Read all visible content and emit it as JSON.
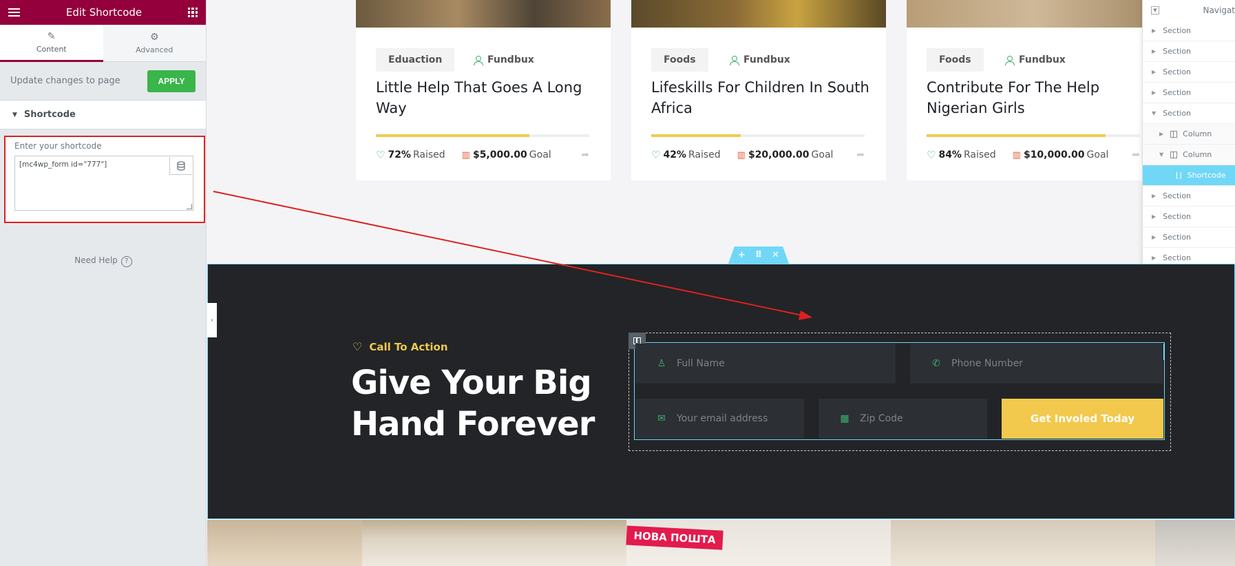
{
  "panel": {
    "title": "Edit Shortcode",
    "tabs": [
      {
        "label": "Content",
        "icon": "pencil-icon"
      },
      {
        "label": "Advanced",
        "icon": "gear-icon"
      }
    ],
    "update_text": "Update changes to page",
    "apply_label": "APPLY",
    "section_title": "Shortcode",
    "shortcode_label": "Enter your shortcode",
    "shortcode_value": "[mc4wp_form id=\"777\"]",
    "need_help": "Need Help"
  },
  "cards": [
    {
      "tag": "Eduaction",
      "author": "Fundbux",
      "title": "Little Help That Goes A Long Way",
      "progress": 0.72,
      "pct": "72%",
      "raised": "Raised",
      "goal_amount": "$5,000.00",
      "goal": "Goal"
    },
    {
      "tag": "Foods",
      "author": "Fundbux",
      "title": "Lifeskills For Children In South Africa",
      "progress": 0.42,
      "pct": "42%",
      "raised": "Raised",
      "goal_amount": "$20,000.00",
      "goal": "Goal"
    },
    {
      "tag": "Foods",
      "author": "Fundbux",
      "title": "Contribute For The Help Nigerian Girls",
      "progress": 0.84,
      "pct": "84%",
      "raised": "Raised",
      "goal_amount": "$10,000.00",
      "goal": "Goal"
    }
  ],
  "navigator": {
    "title": "Navigat",
    "items": [
      "Section",
      "Section",
      "Section",
      "Section",
      "Section",
      "Column",
      "Column",
      "Shortcode",
      "Section",
      "Section",
      "Section",
      "Section"
    ]
  },
  "cta": {
    "label": "Call To Action",
    "title": "Give Your Big Hand Forever",
    "fields": {
      "full_name": "Full Name",
      "phone": "Phone Number",
      "email": "Your email address",
      "zip": "Zip Code"
    },
    "button": "Get Involed Today"
  },
  "photo_sign": "НОВА ПОШТА",
  "colors": {
    "brand": "#93003c",
    "apply": "#39b54a",
    "accent_yellow": "#f2c94c",
    "accent_green": "#3cb371",
    "editor_blue": "#71d7f7",
    "dark_bg": "#222427",
    "annotation_red": "#e02020"
  }
}
